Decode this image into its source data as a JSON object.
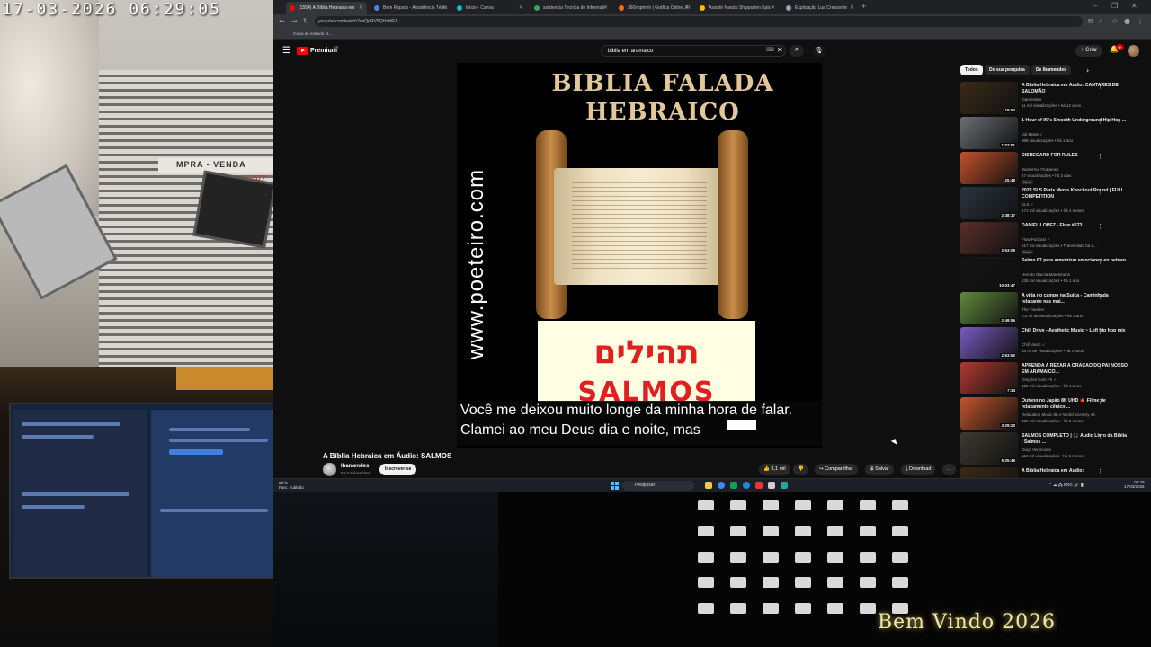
{
  "overlay": {
    "cam_timestamp": "17-03-2026 06:29:05",
    "shop_sign": "MPRA - VENDA",
    "shop_sign_red": "065 7577",
    "welcome_text": "Bem Vindo 2026"
  },
  "browser": {
    "tabs": [
      {
        "label": "(1554) A Bíblia Hebraica em",
        "color": "#ff0000",
        "active": true
      },
      {
        "label": "Bem Reparo - Assistência Técni",
        "color": "#4285f4"
      },
      {
        "label": "Início - Canva",
        "color": "#00c4cc"
      },
      {
        "label": "ssistencia Tecnica de Informati",
        "color": "#34a853"
      },
      {
        "label": "360imprimir | Gráfica Online, Fl",
        "color": "#ff6d00"
      },
      {
        "label": "Assistir Naruto Shippuden Epis",
        "color": "#fbbc05"
      },
      {
        "label": "Explicação Lua Crescente",
        "color": "#9aa0a6"
      }
    ],
    "new_tab": "+",
    "window_controls": [
      "–",
      "❐",
      "✕"
    ],
    "url": "youtube.com/watch?v=QpRV9QHzWE8",
    "bookmark": "Caixa de entrada (1..."
  },
  "youtube": {
    "brand": "Premium",
    "brand_sup": "BR",
    "search_value": "biblia em aramaico",
    "create_label": "Criar",
    "notif_count": "9+",
    "chips": [
      "Todos",
      "Do sua pesquisa",
      "De Ibamendes"
    ],
    "player": {
      "title_line1": "BIBLIA FALADA",
      "title_line2": "HEBRAICO",
      "side_url": "www.poeteiro.com",
      "hebrew": "תהילים",
      "salmos": "SALMOS",
      "subtitle_line1": "Você me deixou muito longe da minha hora de falar.",
      "subtitle_line2": "Clamei ao meu Deus dia e noite, mas"
    },
    "video": {
      "title": "A Bíblia Hebraica em Áudio: SALMOS",
      "channel": "Ibamendes",
      "subscribers": "53,3 mil inscritos",
      "subscribe_label": "Inscrever-se",
      "likes": "3,1 mil",
      "share_label": "Compartilhar",
      "save_label": "Salvar",
      "download_label": "Download",
      "more_label": "..."
    },
    "recommendations": [
      {
        "title": "A Bíblia Hebraica em Áudio: CANTARES DE SALOMÃO",
        "channel": "Ibamendes",
        "meta": "11 mil visualizações • há 12 anos",
        "duration": "19:54",
        "thumb": "#3b2a18",
        "badge": ""
      },
      {
        "title": "1 Hour of 90's Smooth Underground Hip Hop ...",
        "channel": "Vol Beats ✓",
        "meta": "969 visualizações • há 1 ano",
        "duration": "1:02:51",
        "thumb": "#6b6f74",
        "badge": ""
      },
      {
        "title": "DISREGARD FOR RULES",
        "channel": "Валентин Псаренко",
        "meta": "47 visualizações • há 3 dias",
        "duration": "25:48",
        "thumb": "#c4502a",
        "badge": "Novo"
      },
      {
        "title": "2025 SLS Paris Men's Knockout Round | FULL COMPETITION",
        "channel": "SLS ✓",
        "meta": "171 mil visualizações • há 4 meses",
        "duration": "2:38:17",
        "thumb": "#2a3440",
        "badge": ""
      },
      {
        "title": "DANIEL LOPEZ - Flow #573",
        "channel": "Flow Podcast ✓",
        "meta": "517 mil visualizações • Transmitido há 2...",
        "duration": "2:53:09",
        "thumb": "#5a2e2a",
        "badge": "Novo"
      },
      {
        "title": "Salmo 67 para armonizar emociones en hebreo.",
        "channel": "Hernán Garcia Maresmans",
        "meta": "135 mil visualizações • há 1 ano",
        "duration": "10:03:47",
        "thumb": "#141414",
        "badge": ""
      },
      {
        "title": "A vida no campo na Suíça - Caminhada relaxante nas mai...",
        "channel": "The Traveler",
        "meta": "8,5 mi de visualizações • há 1 ano",
        "duration": "2:49:55",
        "thumb": "#5f8a3c",
        "badge": ""
      },
      {
        "title": "Chill Drive - Aesthetic Music ~ Lofi hip hop mix",
        "channel": "Chill Music ✓",
        "meta": "16 mi de visualizações • há 4 anos",
        "duration": "2:53:52",
        "thumb": "#7b5bc4",
        "badge": ""
      },
      {
        "title": "APRENDA A REZAR A ORAÇÃO DO PAI NOSSO EM ARAMAICO...",
        "channel": "Orações Com Fé ✓",
        "meta": "125 mil visualizações • há 4 anos",
        "duration": "7:34",
        "thumb": "#b13a2f",
        "badge": ""
      },
      {
        "title": "Outono no Japão 8K UHD 🍁 Filme de relaxamento cênico ...",
        "channel": "Relaxation Music 8K e World Scenery 4K",
        "meta": "406 mil visualizações • há 5 meses",
        "duration": "3:29:23",
        "thumb": "#c4562b",
        "badge": ""
      },
      {
        "title": "SALMOS COMPLETO | 🎧 Áudio Livro da Bíblia | Salmos ...",
        "channel": "Ouça Versículos",
        "meta": "116 mil visualizações • há 6 meses",
        "duration": "5:25:46",
        "thumb": "#3e3a30",
        "badge": ""
      },
      {
        "title": "A Bíblia Hebraica em Áudio:",
        "channel": "",
        "meta": "",
        "duration": "",
        "thumb": "#3b2a18",
        "badge": ""
      }
    ]
  },
  "taskbar": {
    "weather_temp": "25°C",
    "weather_desc": "Parc. nublado",
    "search_label": "Pesquisar",
    "tray": "⌃  ☁  🖧  ENG  🔊  🔋",
    "time": "06:29",
    "date": "17/03/2026"
  }
}
